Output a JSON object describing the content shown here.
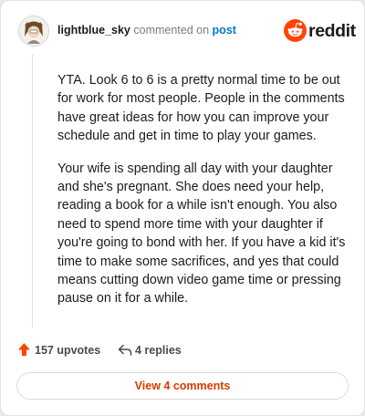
{
  "header": {
    "username": "lightblue_sky",
    "action_text": "commented on",
    "post_link": "post"
  },
  "brand": {
    "name": "reddit",
    "accent": "#ff4500"
  },
  "comment": {
    "paragraphs": [
      "YTA. Look 6 to 6 is a pretty normal time to be out for work for most people. People in the comments have great ideas for how you can improve your schedule and get in time to play your games.",
      "Your wife is spending all day with your daughter and she's pregnant. She does need your help, reading a book for a while isn't enough. You also need to spend more time with your daughter if you're going to bond with her. If you have a kid it's time to make some sacrifices, and yes that could means cutting down video game time or pressing pause on it for a while."
    ]
  },
  "actions": {
    "upvotes": "157 upvotes",
    "replies": "4 replies",
    "upvote_color": "#ff4500"
  },
  "footer": {
    "view_comments_label": "View 4 comments",
    "label_color": "#d93a00"
  },
  "icons": {
    "avatar": "avatar",
    "logo": "reddit-snoo-icon",
    "upvote": "upvote-arrow-icon",
    "reply": "reply-arrow-icon"
  }
}
